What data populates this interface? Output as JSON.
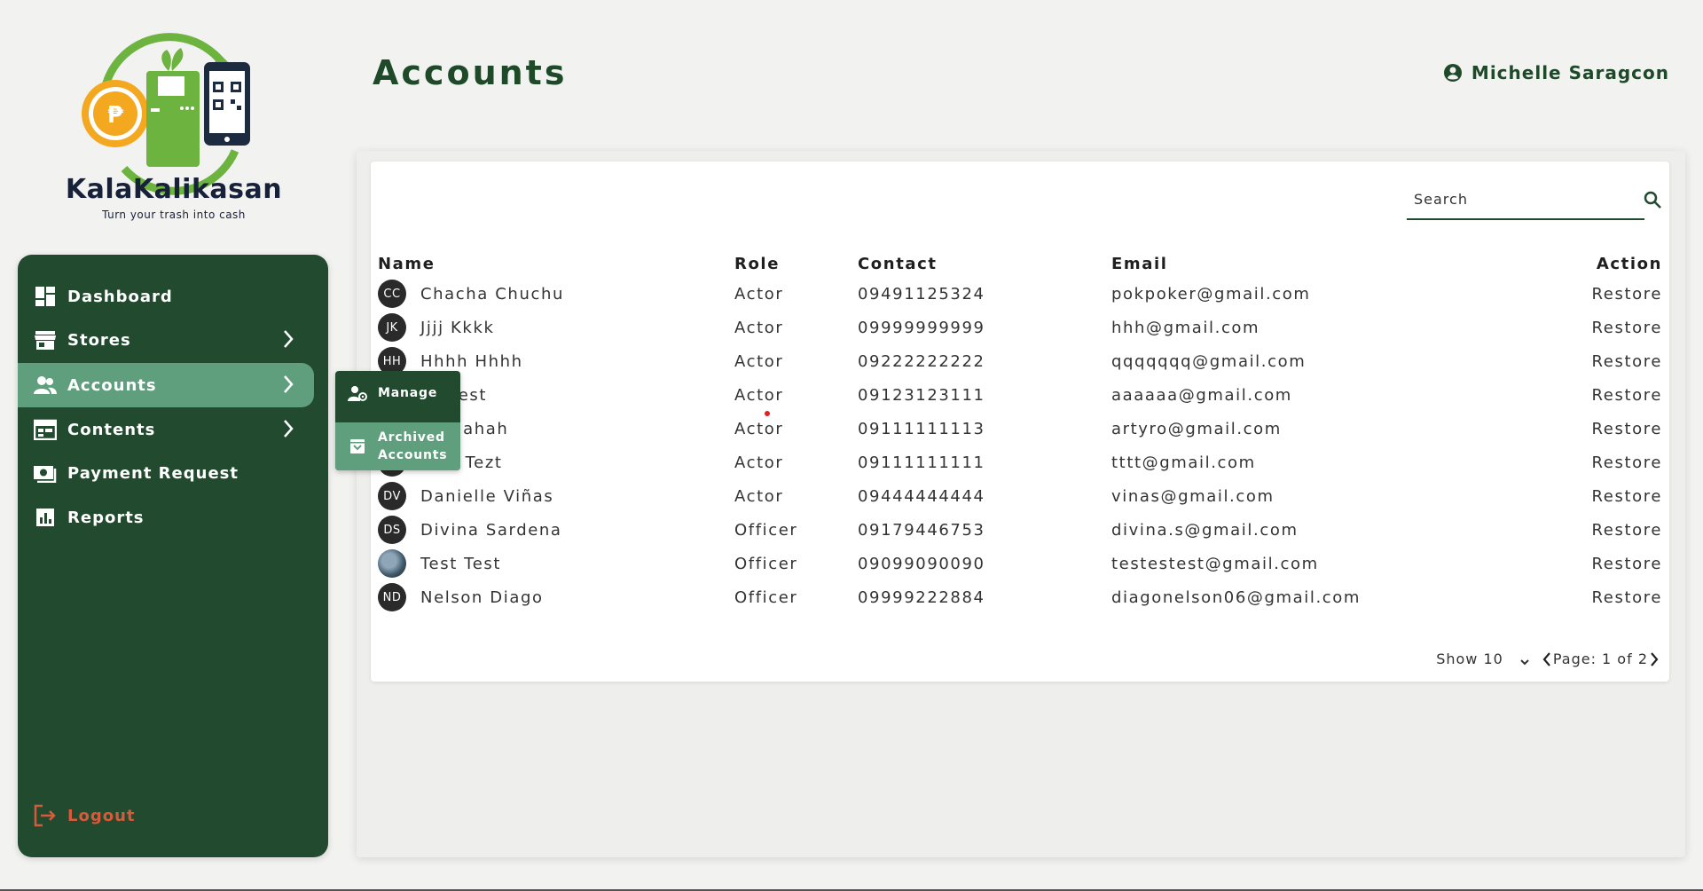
{
  "brand": {
    "name": "KalaKalikasan",
    "tagline": "Turn your trash into cash"
  },
  "sidebar": {
    "items": [
      {
        "label": "Dashboard",
        "icon": "dashboard-icon"
      },
      {
        "label": "Stores",
        "icon": "store-icon"
      },
      {
        "label": "Accounts",
        "icon": "users-icon"
      },
      {
        "label": "Contents",
        "icon": "calendar-icon"
      },
      {
        "label": "Payment Request",
        "icon": "payment-icon"
      },
      {
        "label": "Reports",
        "icon": "chart-icon"
      }
    ],
    "logout": "Logout"
  },
  "submenu": {
    "manage": "Manage",
    "archived_line1": "Archived",
    "archived_line2": "Accounts"
  },
  "header": {
    "title": "Accounts",
    "user": "Michelle Saragcon"
  },
  "search": {
    "placeholder": "Search"
  },
  "table": {
    "headers": {
      "name": "Name",
      "role": "Role",
      "contact": "Contact",
      "email": "Email",
      "action": "Action"
    },
    "rows": [
      {
        "initials": "CC",
        "name": "Chacha Chuchu",
        "role": "Actor",
        "contact": "09491125324",
        "email": "pokpoker@gmail.com",
        "action": "Restore"
      },
      {
        "initials": "JK",
        "name": "Jjjj Kkkk",
        "role": "Actor",
        "contact": "09999999999",
        "email": "hhh@gmail.com",
        "action": "Restore"
      },
      {
        "initials": "HH",
        "name": "Hhhh Hhhh",
        "role": "Actor",
        "contact": "09222222222",
        "email": "qqqqqqq@gmail.com",
        "action": "Restore"
      },
      {
        "initials": "",
        "name": "ile Test",
        "role": "Actor",
        "contact": "09123123111",
        "email": "aaaaaa@gmail.com",
        "action": "Restore"
      },
      {
        "initials": "",
        "name": "ah Hahah",
        "role": "Actor",
        "contact": "09111111113",
        "email": "artyro@gmail.com",
        "action": "Restore"
      },
      {
        "initials": "",
        "name": "esst Tezt",
        "role": "Actor",
        "contact": "09111111111",
        "email": "tttt@gmail.com",
        "action": "Restore"
      },
      {
        "initials": "DV",
        "name": "Danielle Viñas",
        "role": "Actor",
        "contact": "09444444444",
        "email": "vinas@gmail.com",
        "action": "Restore"
      },
      {
        "initials": "DS",
        "name": "Divina Sardena",
        "role": "Officer",
        "contact": "09179446753",
        "email": "divina.s@gmail.com",
        "action": "Restore"
      },
      {
        "initials": "",
        "name": "Test Test",
        "role": "Officer",
        "contact": "09099090090",
        "email": "testestest@gmail.com",
        "action": "Restore"
      },
      {
        "initials": "ND",
        "name": "Nelson Diago",
        "role": "Officer",
        "contact": "09999222884",
        "email": "diagonelson06@gmail.com",
        "action": "Restore"
      }
    ]
  },
  "pagination": {
    "show": "Show 10",
    "page": "Page: 1 of 2"
  },
  "colors": {
    "sidebar": "#214a2e",
    "active": "#5f9f7e",
    "logout": "#d95a3a",
    "title": "#1e4a2a"
  }
}
